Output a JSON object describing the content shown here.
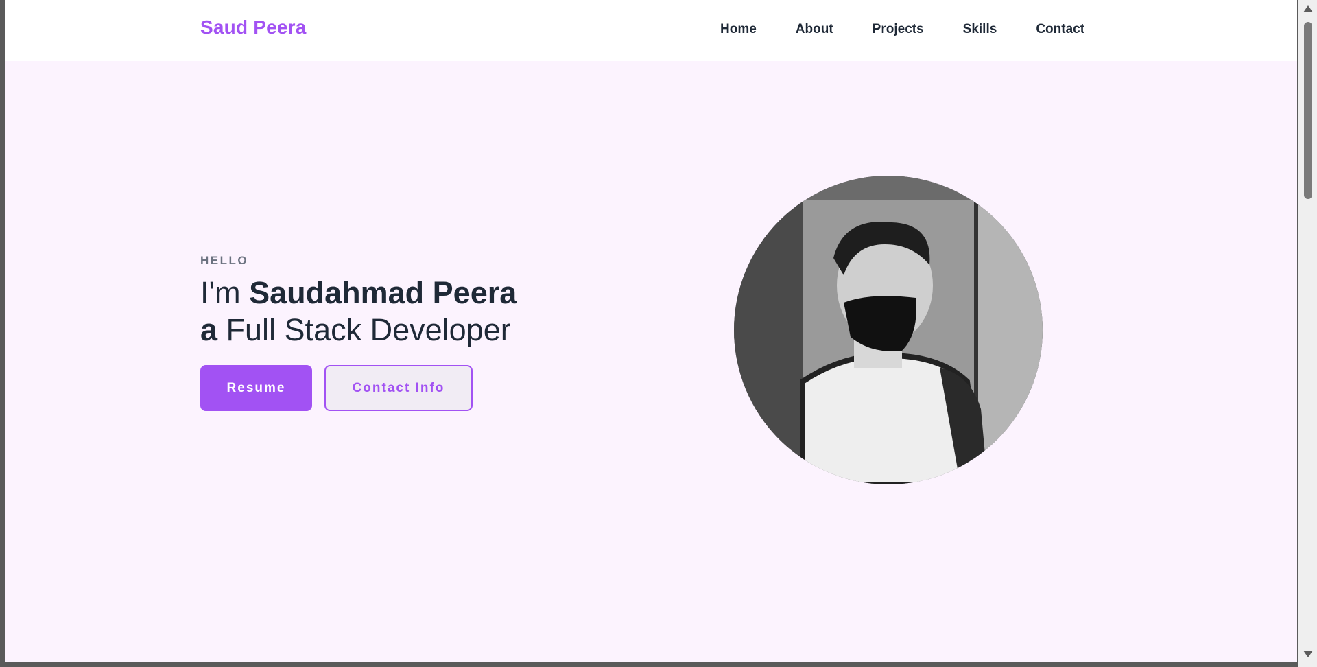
{
  "header": {
    "brand": "Saud Peera",
    "nav": [
      "Home",
      "About",
      "Projects",
      "Skills",
      "Contact"
    ]
  },
  "hero": {
    "eyebrow": "HELLO",
    "line1_prefix": "I'm ",
    "line1_name": "Saudahmad Peera",
    "line2_prefix": "a",
    "line2_rest": " Full Stack Developer",
    "resume_label": "Resume",
    "contact_label": "Contact Info"
  },
  "colors": {
    "accent": "#a252f3",
    "background": "#fcf3fe",
    "text": "#1f2937"
  },
  "icons": {
    "portrait": "profile-photo"
  }
}
